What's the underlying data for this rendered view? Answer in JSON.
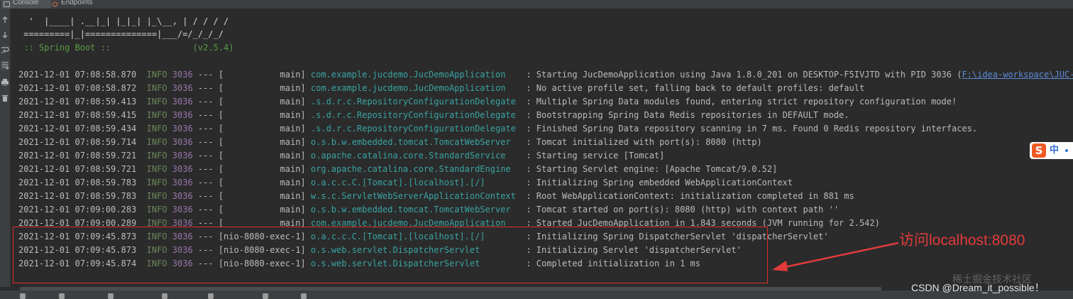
{
  "tabs": [
    {
      "label": "Console"
    },
    {
      "label": "Endpoints"
    }
  ],
  "banner": [
    "  '  |____| .__|_| |_|_| |_\\__, | / / / /",
    " =========|_|==============|___/=/_/_/_/",
    " :: Spring Boot ::                (v2.5.4)"
  ],
  "log": [
    {
      "time": "2021-12-01 07:08:58.870",
      "level": "INFO",
      "pid": "3036",
      "sep": "---",
      "thread": "[           main]",
      "logger": "com.example.jucdemo.JucDemoApplication   ",
      "msg": ": Starting JucDemoApplication using Java 1.8.0_201 on DESKTOP-F5IVJTD with PID 3036 (",
      "link": "F:\\idea-workspace\\JUC-example\\ta"
    },
    {
      "time": "2021-12-01 07:08:58.872",
      "level": "INFO",
      "pid": "3036",
      "sep": "---",
      "thread": "[           main]",
      "logger": "com.example.jucdemo.JucDemoApplication   ",
      "msg": ": No active profile set, falling back to default profiles: default"
    },
    {
      "time": "2021-12-01 07:08:59.413",
      "level": "INFO",
      "pid": "3036",
      "sep": "---",
      "thread": "[           main]",
      "logger": ".s.d.r.c.RepositoryConfigurationDelegate ",
      "msg": ": Multiple Spring Data modules found, entering strict repository configuration mode!"
    },
    {
      "time": "2021-12-01 07:08:59.415",
      "level": "INFO",
      "pid": "3036",
      "sep": "---",
      "thread": "[           main]",
      "logger": ".s.d.r.c.RepositoryConfigurationDelegate ",
      "msg": ": Bootstrapping Spring Data Redis repositories in DEFAULT mode."
    },
    {
      "time": "2021-12-01 07:08:59.434",
      "level": "INFO",
      "pid": "3036",
      "sep": "---",
      "thread": "[           main]",
      "logger": ".s.d.r.c.RepositoryConfigurationDelegate ",
      "msg": ": Finished Spring Data repository scanning in 7 ms. Found 0 Redis repository interfaces."
    },
    {
      "time": "2021-12-01 07:08:59.714",
      "level": "INFO",
      "pid": "3036",
      "sep": "---",
      "thread": "[           main]",
      "logger": "o.s.b.w.embedded.tomcat.TomcatWebServer  ",
      "msg": ": Tomcat initialized with port(s): 8080 (http)"
    },
    {
      "time": "2021-12-01 07:08:59.721",
      "level": "INFO",
      "pid": "3036",
      "sep": "---",
      "thread": "[           main]",
      "logger": "o.apache.catalina.core.StandardService   ",
      "msg": ": Starting service [Tomcat]"
    },
    {
      "time": "2021-12-01 07:08:59.721",
      "level": "INFO",
      "pid": "3036",
      "sep": "---",
      "thread": "[           main]",
      "logger": "org.apache.catalina.core.StandardEngine  ",
      "msg": ": Starting Servlet engine: [Apache Tomcat/9.0.52]"
    },
    {
      "time": "2021-12-01 07:08:59.783",
      "level": "INFO",
      "pid": "3036",
      "sep": "---",
      "thread": "[           main]",
      "logger": "o.a.c.c.C.[Tomcat].[localhost].[/]       ",
      "msg": ": Initializing Spring embedded WebApplicationContext"
    },
    {
      "time": "2021-12-01 07:08:59.783",
      "level": "INFO",
      "pid": "3036",
      "sep": "---",
      "thread": "[           main]",
      "logger": "w.s.c.ServletWebServerApplicationContext ",
      "msg": ": Root WebApplicationContext: initialization completed in 881 ms"
    },
    {
      "time": "2021-12-01 07:09:00.283",
      "level": "INFO",
      "pid": "3036",
      "sep": "---",
      "thread": "[           main]",
      "logger": "o.s.b.w.embedded.tomcat.TomcatWebServer  ",
      "msg": ": Tomcat started on port(s): 8080 (http) with context path ''"
    },
    {
      "time": "2021-12-01 07:09:00.289",
      "level": "INFO",
      "pid": "3036",
      "sep": "---",
      "thread": "[           main]",
      "logger": "com.example.jucdemo.JucDemoApplication   ",
      "msg": ": Started JucDemoApplication in 1.843 seconds (JVM running for 2.542)"
    },
    {
      "time": "2021-12-01 07:09:45.873",
      "level": "INFO",
      "pid": "3036",
      "sep": "---",
      "thread": "[nio-8080-exec-1]",
      "logger": "o.a.c.c.C.[Tomcat].[localhost].[/]       ",
      "msg": ": Initializing Spring DispatcherServlet 'dispatcherServlet'"
    },
    {
      "time": "2021-12-01 07:09:45.873",
      "level": "INFO",
      "pid": "3036",
      "sep": "---",
      "thread": "[nio-8080-exec-1]",
      "logger": "o.s.web.servlet.DispatcherServlet        ",
      "msg": ": Initializing Servlet 'dispatcherServlet'"
    },
    {
      "time": "2021-12-01 07:09:45.874",
      "level": "INFO",
      "pid": "3036",
      "sep": "---",
      "thread": "[nio-8080-exec-1]",
      "logger": "o.s.web.servlet.DispatcherServlet        ",
      "msg": ": Completed initialization in 1 ms"
    }
  ],
  "annotation": {
    "text": "访问localhost:8080",
    "color": "#e23b3b"
  },
  "ime": {
    "logo": "S",
    "mode": "中"
  },
  "watermark": {
    "primary": "稀土掘金技术社区",
    "secondary": "CSDN @Dream_it_possible！"
  },
  "colors": {
    "background": "#2b2b2b",
    "info": "#6a8759",
    "pid": "#9876aa",
    "logger": "#3aa3a3",
    "highlight": "#d9302e"
  },
  "icons": {
    "gutter": [
      "arrow-up-icon",
      "arrow-down-icon",
      "soft-wrap-icon",
      "scroll-to-end-icon",
      "print-icon",
      "trash-icon"
    ]
  }
}
